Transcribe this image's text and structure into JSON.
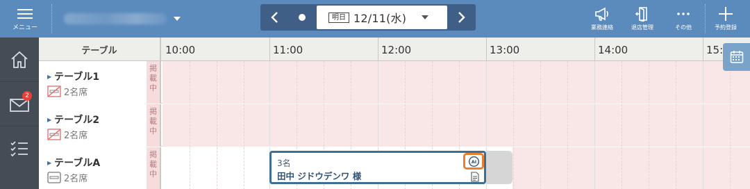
{
  "topbar": {
    "menu_label": "メニュー",
    "date": {
      "day_tag": "明日",
      "date_text": "12/11(水)"
    },
    "tools": [
      {
        "icon": "megaphone-icon",
        "label": "業務連絡"
      },
      {
        "icon": "door-exit-icon",
        "label": "退店管理"
      },
      {
        "icon": "more-dots-icon",
        "label": "その他"
      },
      {
        "icon": "plus-icon",
        "label": "予約登録"
      }
    ]
  },
  "sidenav": {
    "items": [
      {
        "icon": "home-icon"
      },
      {
        "icon": "mail-icon",
        "badge": "2"
      },
      {
        "icon": "checklist-icon"
      }
    ]
  },
  "grid": {
    "table_header": "テーブル",
    "hours": [
      "10:00",
      "11:00",
      "12:00",
      "13:00",
      "14:00",
      "15:"
    ],
    "rows": [
      {
        "name": "テーブル1",
        "seats": "2名席",
        "status": "掲載中"
      },
      {
        "name": "テーブル2",
        "seats": "2名席",
        "status": "掲載中"
      },
      {
        "name": "テーブルA",
        "seats": "2名席",
        "status": "掲載中"
      }
    ],
    "reservation": {
      "count": "3名",
      "guest": "田中 ジドウデンワ 様"
    }
  },
  "colors": {
    "topbar": "#5b8bbd",
    "sidenav": "#444c56",
    "unavailable": "#f9e6e7",
    "reservation_border": "#3f6f94",
    "ai_highlight": "#e8812f",
    "badge": "#e8413a"
  }
}
